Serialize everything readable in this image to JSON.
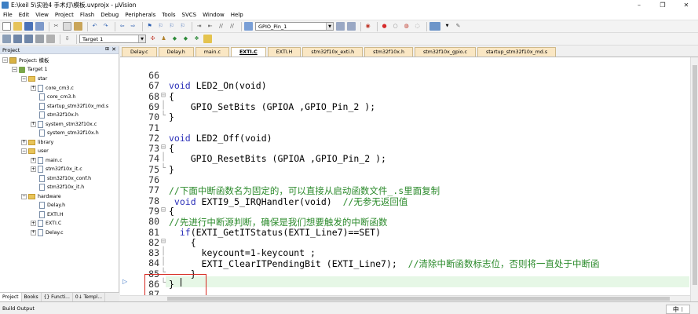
{
  "window": {
    "title": "E:\\keil 5\\实验4 手术灯\\模板.uvprojx - µVision",
    "minimize": "–",
    "maximize": "❐",
    "close": "✕"
  },
  "menu": [
    "File",
    "Edit",
    "View",
    "Project",
    "Flash",
    "Debug",
    "Peripherals",
    "Tools",
    "SVCS",
    "Window",
    "Help"
  ],
  "toolbar": {
    "find_combo_value": "GPIO_Pin_1",
    "target_combo_value": "Target 1"
  },
  "project_panel": {
    "title": "Project",
    "root": "Project: 模板",
    "target": "Target 1",
    "groups": {
      "star": [
        "core_cm3.c",
        "core_cm3.h",
        "startup_stm32f10x_md.s",
        "stm32f10x.h",
        "system_stm32f10x.c",
        "system_stm32f10x.h"
      ],
      "library": [],
      "user": [
        "main.c",
        "stm32f10x_it.c",
        "stm32f10x_conf.h",
        "stm32f10x_it.h"
      ],
      "hardware": [
        "Delay.h",
        "EXTI.H",
        "EXTI.C",
        "Delay.c"
      ]
    },
    "group_names": [
      "star",
      "library",
      "user",
      "hardware"
    ],
    "bottom_tabs": [
      "Project",
      "Books",
      "{} Functi...",
      "0↓ Templ..."
    ]
  },
  "editor": {
    "tabs": [
      "Delay.c",
      "Delay.h",
      "main.c",
      "EXTI.C",
      "EXTI.H",
      "stm32f10x_exti.h",
      "stm32f10x.h",
      "stm32f10x_gpio.c",
      "startup_stm32f10x_md.s"
    ],
    "active_tab": "EXTI.C",
    "line_numbers": [
      "66",
      "67",
      "68",
      "69",
      "70",
      "71",
      "72",
      "73",
      "74",
      "75",
      "76",
      "77",
      "78",
      "79",
      "80",
      "81",
      "82",
      "83",
      "84",
      "85",
      "86",
      "87"
    ],
    "lines": [
      {
        "kw": "",
        "text": "",
        "cm": ""
      },
      {
        "kw": "void",
        "text": " LED2_On(void)",
        "cm": ""
      },
      {
        "kw": "",
        "text": "{",
        "cm": ""
      },
      {
        "kw": "",
        "text": "    GPIO_SetBits (GPIOA ,GPIO_Pin_2 );",
        "cm": ""
      },
      {
        "kw": "",
        "text": "}",
        "cm": ""
      },
      {
        "kw": "",
        "text": "",
        "cm": ""
      },
      {
        "kw": "void",
        "text": " LED2_Off(void)",
        "cm": ""
      },
      {
        "kw": "",
        "text": "{",
        "cm": ""
      },
      {
        "kw": "",
        "text": "    GPIO_ResetBits (GPIOA ,GPIO_Pin_2 );",
        "cm": ""
      },
      {
        "kw": "",
        "text": "}",
        "cm": ""
      },
      {
        "kw": "",
        "text": "",
        "cm": ""
      },
      {
        "kw": "",
        "text": "",
        "cm": "//下面中断函数名为固定的，可以直接从启动函数文件_.s里面复制"
      },
      {
        "kw": " void",
        "text": " EXTI9_5_IRQHandler(void)  ",
        "cm": "//无参无返回值"
      },
      {
        "kw": "",
        "text": "{",
        "cm": ""
      },
      {
        "kw": "",
        "text": "",
        "cm": "//先进行中断源判断，确保是我们想要触发的中断函数"
      },
      {
        "kw": "  if",
        "text": "(EXTI_GetITStatus(EXTI_Line7)==SET)",
        "cm": ""
      },
      {
        "kw": "",
        "text": "    {",
        "cm": ""
      },
      {
        "kw": "",
        "text": "      keycount=1-keycount ;",
        "cm": ""
      },
      {
        "kw": "",
        "text": "      EXTI_ClearITPendingBit (EXTI_Line7);  ",
        "cm": "//清除中断函数标志位，否则将一直处于中断函"
      },
      {
        "kw": "",
        "text": "    }",
        "cm": ""
      },
      {
        "kw": "",
        "text": "}",
        "cm": ""
      },
      {
        "kw": "",
        "text": "",
        "cm": ""
      }
    ]
  },
  "build_output": {
    "title": "Build Output"
  },
  "ime": {
    "label": "中 ⁝"
  },
  "colors": {
    "keyword": "#2a2fb8",
    "comment": "#2b8a2b",
    "highlight": "#d6281f",
    "current_line": "#e6f7e6"
  }
}
